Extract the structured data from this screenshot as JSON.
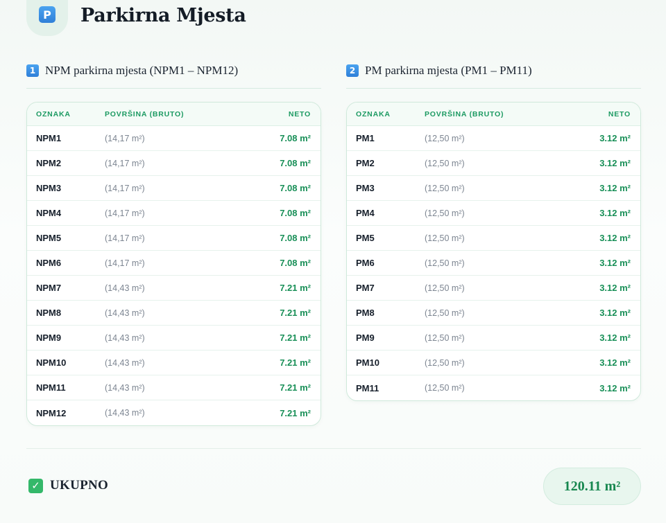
{
  "header": {
    "icon_letter": "P",
    "title": "Parkirna Mjesta"
  },
  "sections": [
    {
      "number": "1",
      "title": "NPM parkirna mjesta (NPM1 – NPM12)",
      "columns": [
        "OZNAKA",
        "POVRŠINA (BRUTO)",
        "NETO"
      ],
      "rows": [
        {
          "code": "NPM1",
          "bruto": "(14,17 m²)",
          "neto": "7.08 m²"
        },
        {
          "code": "NPM2",
          "bruto": "(14,17 m²)",
          "neto": "7.08 m²"
        },
        {
          "code": "NPM3",
          "bruto": "(14,17 m²)",
          "neto": "7.08 m²"
        },
        {
          "code": "NPM4",
          "bruto": "(14,17 m²)",
          "neto": "7.08 m²"
        },
        {
          "code": "NPM5",
          "bruto": "(14,17 m²)",
          "neto": "7.08 m²"
        },
        {
          "code": "NPM6",
          "bruto": "(14,17 m²)",
          "neto": "7.08 m²"
        },
        {
          "code": "NPM7",
          "bruto": "(14,43 m²)",
          "neto": "7.21 m²"
        },
        {
          "code": "NPM8",
          "bruto": "(14,43 m²)",
          "neto": "7.21 m²"
        },
        {
          "code": "NPM9",
          "bruto": "(14,43 m²)",
          "neto": "7.21 m²"
        },
        {
          "code": "NPM10",
          "bruto": "(14,43 m²)",
          "neto": "7.21 m²"
        },
        {
          "code": "NPM11",
          "bruto": "(14,43 m²)",
          "neto": "7.21 m²"
        },
        {
          "code": "NPM12",
          "bruto": "(14,43 m²)",
          "neto": "7.21 m²"
        }
      ]
    },
    {
      "number": "2",
      "title": "PM parkirna mjesta (PM1 – PM11)",
      "columns": [
        "OZNAKA",
        "POVRŠINA (BRUTO)",
        "NETO"
      ],
      "rows": [
        {
          "code": "PM1",
          "bruto": "(12,50 m²)",
          "neto": "3.12 m²"
        },
        {
          "code": "PM2",
          "bruto": "(12,50 m²)",
          "neto": "3.12 m²"
        },
        {
          "code": "PM3",
          "bruto": "(12,50 m²)",
          "neto": "3.12 m²"
        },
        {
          "code": "PM4",
          "bruto": "(12,50 m²)",
          "neto": "3.12 m²"
        },
        {
          "code": "PM5",
          "bruto": "(12,50 m²)",
          "neto": "3.12 m²"
        },
        {
          "code": "PM6",
          "bruto": "(12,50 m²)",
          "neto": "3.12 m²"
        },
        {
          "code": "PM7",
          "bruto": "(12,50 m²)",
          "neto": "3.12 m²"
        },
        {
          "code": "PM8",
          "bruto": "(12,50 m²)",
          "neto": "3.12 m²"
        },
        {
          "code": "PM9",
          "bruto": "(12,50 m²)",
          "neto": "3.12 m²"
        },
        {
          "code": "PM10",
          "bruto": "(12,50 m²)",
          "neto": "3.12 m²"
        },
        {
          "code": "PM11",
          "bruto": "(12,50 m²)",
          "neto": "3.12 m²"
        }
      ]
    }
  ],
  "total": {
    "icon_glyph": "✓",
    "label": "UKUPNO",
    "value": "120.11 m²"
  },
  "colors": {
    "accent_green": "#188f57",
    "header_green": "#1c9a62",
    "icon_blue": "#2f7fd8",
    "check_green": "#34b86a"
  }
}
